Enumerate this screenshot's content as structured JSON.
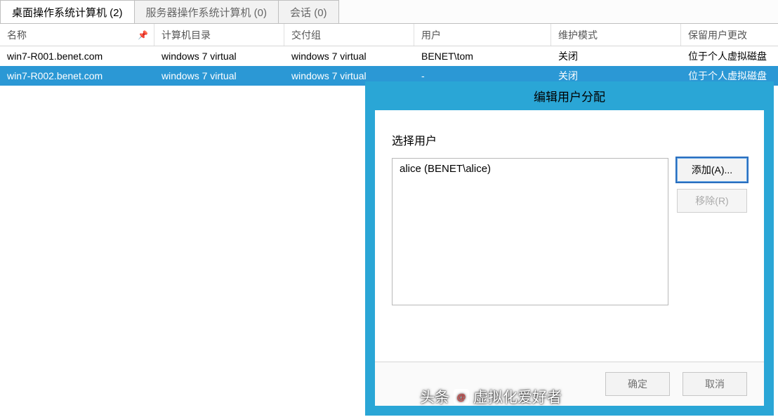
{
  "tabs": [
    {
      "label": "桌面操作系统计算机 (2)"
    },
    {
      "label": "服务器操作系统计算机 (0)"
    },
    {
      "label": "会话 (0)"
    }
  ],
  "columns": {
    "name": "名称",
    "folder": "计算机目录",
    "delivery": "交付组",
    "user": "用户",
    "mode": "维护模式",
    "keep": "保留用户更改"
  },
  "pin_glyph": "📌",
  "rows": [
    {
      "name": "win7-R001.benet.com",
      "folder": "windows 7 virtual",
      "delivery": "windows 7 virtual",
      "user": "BENET\\tom",
      "mode": "关闭",
      "keep": "位于个人虚拟磁盘"
    },
    {
      "name": "win7-R002.benet.com",
      "folder": "windows 7 virtual",
      "delivery": "windows 7 virtual",
      "user": "-",
      "mode": "关闭",
      "keep": "位于个人虚拟磁盘"
    }
  ],
  "dialog": {
    "title": "编辑用户分配",
    "select_label": "选择用户",
    "list_item": "alice (BENET\\alice)",
    "add_btn": "添加(A)...",
    "remove_btn": "移除(R)",
    "ok_btn": "确定",
    "cancel_btn": "取消"
  },
  "watermark": {
    "prefix": "头条",
    "badge": "@",
    "text": "虚拟化爱好者"
  }
}
